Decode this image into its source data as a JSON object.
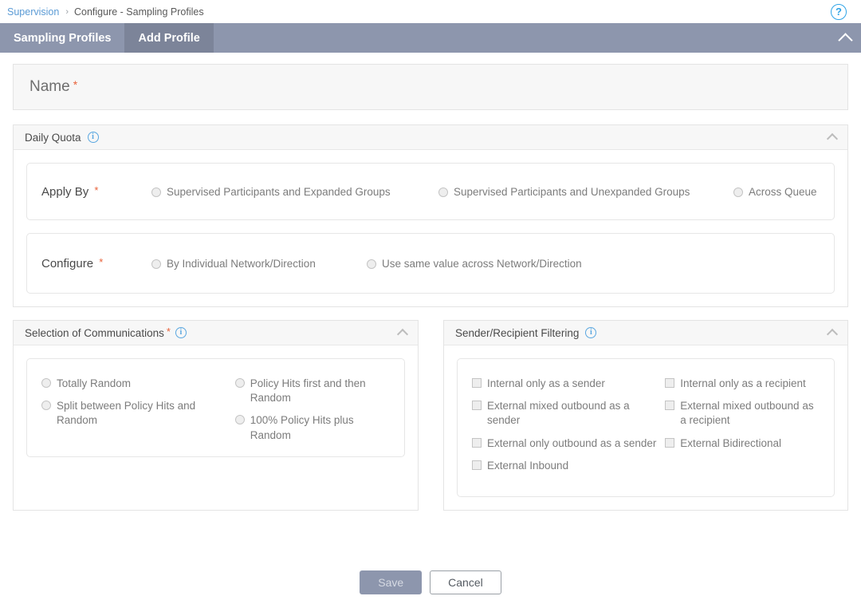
{
  "breadcrumb": {
    "root_label": "Supervision",
    "separator": "›",
    "current_label": "Configure - Sampling Profiles",
    "help_glyph": "?"
  },
  "tabs": {
    "items": [
      {
        "label": "Sampling Profiles",
        "active": false
      },
      {
        "label": "Add Profile",
        "active": true
      }
    ]
  },
  "name_field": {
    "label": "Name",
    "required_marker": "*"
  },
  "daily_quota": {
    "title": "Daily Quota",
    "info_glyph": "i",
    "apply_by": {
      "label": "Apply By",
      "required_marker": "*",
      "options": [
        "Supervised Participants and Expanded Groups",
        "Supervised Participants and Unexpanded Groups",
        "Across Queue"
      ]
    },
    "configure": {
      "label": "Configure",
      "required_marker": "*",
      "options": [
        "By Individual Network/Direction",
        "Use same value across Network/Direction"
      ]
    }
  },
  "selection_of_communications": {
    "title": "Selection of Communications",
    "required_marker": "*",
    "info_glyph": "i",
    "column_left": [
      "Totally Random",
      "Split between Policy Hits and Random"
    ],
    "column_right": [
      "Policy Hits first and then Random",
      "100% Policy Hits plus Random"
    ]
  },
  "sender_recipient_filtering": {
    "title": "Sender/Recipient Filtering",
    "info_glyph": "i",
    "column_left": [
      "Internal only as a sender",
      "External mixed outbound as a sender",
      "External only outbound as a sender",
      "External Inbound"
    ],
    "column_right": [
      "Internal only as a recipient",
      "External mixed outbound as a recipient",
      "External Bidirectional"
    ]
  },
  "footer": {
    "save_label": "Save",
    "cancel_label": "Cancel"
  },
  "colors": {
    "tabbar": "#8d96ad",
    "tab_active": "#7c8499",
    "link": "#5b9bd5",
    "required": "#e8623a",
    "info": "#5aa7e0"
  }
}
